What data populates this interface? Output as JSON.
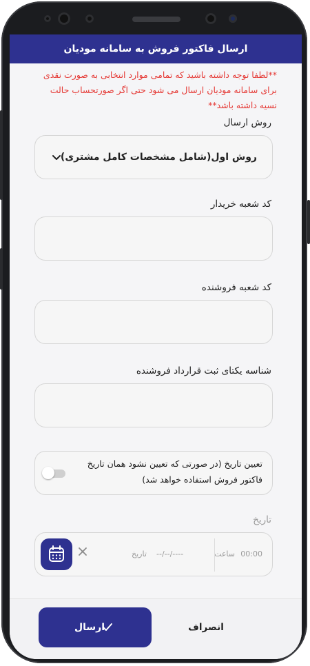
{
  "header": {
    "title": "ارسال فاکتور فروش به سامانه مودیان"
  },
  "notice": {
    "text": "**لطفا توجه داشته باشید که تمامی موارد انتخابی به صورت نقدی برای سامانه مودیان ارسال می شود حتی اگر صورتحساب حالت نسیه داشته باشد**"
  },
  "send_method": {
    "label": "روش ارسال",
    "selected": "روش اول(شامل مشخصات کامل مشتری)"
  },
  "buyer_branch": {
    "label": "کد شعبه خریدار",
    "value": ""
  },
  "seller_branch": {
    "label": "کد شعبه فروشنده",
    "value": ""
  },
  "seller_contract": {
    "label": "شناسه یکتای ثبت قرارداد فروشنده",
    "value": ""
  },
  "date_toggle": {
    "text": "تعیین تاریخ (در صورتی که تعیین نشود همان تاریخ فاکتور فروش استفاده خواهد شد)",
    "enabled": false
  },
  "date": {
    "label": "تاریخ",
    "time_placeholder": "00:00",
    "time_label": "ساعت",
    "date_placeholder": "----/--/--",
    "date_label": "تاریخ"
  },
  "footer": {
    "send_label": "ارسال",
    "cancel_label": "انصراف"
  },
  "colors": {
    "primary": "#2e3190",
    "notice": "#e53935"
  }
}
